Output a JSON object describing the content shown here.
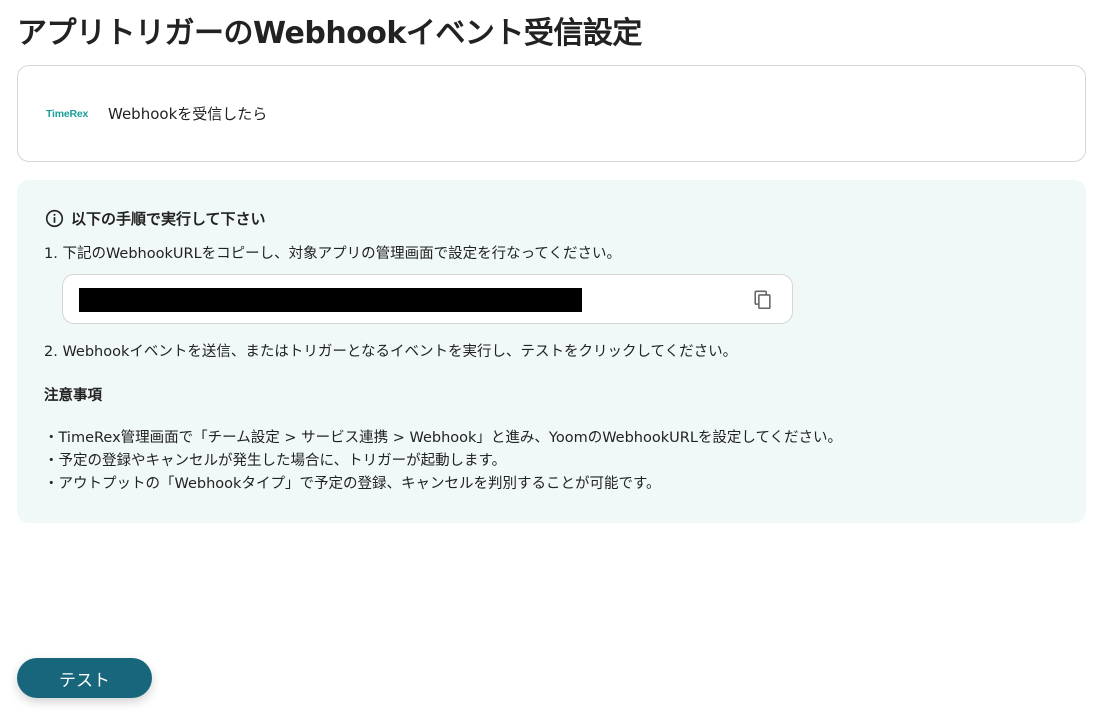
{
  "page": {
    "title": "アプリトリガーのWebhookイベント受信設定"
  },
  "trigger_card": {
    "app_logo_text": "TimeRex",
    "app_logo_sub": "",
    "label": "Webhookを受信したら"
  },
  "instructions": {
    "heading": "以下の手順で実行して下さい",
    "step1": "1. 下記のWebhookURLをコピーし、対象アプリの管理画面で設定を行なってください。",
    "webhook_url": "",
    "step2": "2. Webhookイベントを送信、またはトリガーとなるイベントを実行し、テストをクリックしてください。",
    "notice_heading": "注意事項",
    "notices": [
      "・TimeRex管理画面で「チーム設定 > サービス連携 > Webhook」と進み、YoomのWebhookURLを設定してください。",
      "・予定の登録やキャンセルが発生した場合に、トリガーが起動します。",
      "・アウトプットの「Webhookタイプ」で予定の登録、キャンセルを判別することが可能です。"
    ]
  },
  "buttons": {
    "test_label": "テスト"
  },
  "colors": {
    "primary_button": "#17667c",
    "panel_background": "#f1f8f8",
    "logo_accent": "#1a9f9a"
  },
  "icons": {
    "info": "info-circle-icon",
    "copy": "copy-icon"
  }
}
